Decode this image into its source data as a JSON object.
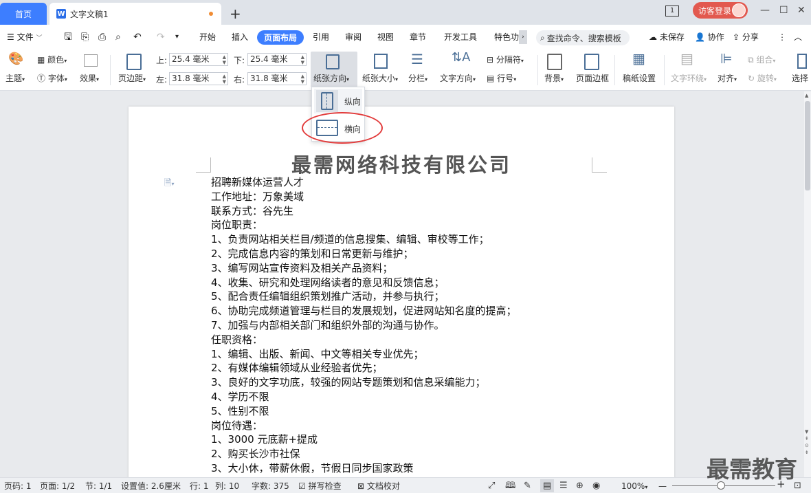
{
  "titlebar": {
    "home_tab": "首页",
    "doc_tab": "文字文稿1",
    "new_tab": "+",
    "page_indicator": "1",
    "login": "访客登录",
    "min": "—",
    "max": "☐",
    "close": "✕"
  },
  "menubar": {
    "file": "文件",
    "tabs": [
      "开始",
      "插入",
      "页面布局",
      "引用",
      "审阅",
      "视图",
      "章节",
      "开发工具",
      "特色功"
    ],
    "active_tab": "页面布局",
    "search": "查找命令、搜索模板",
    "unsaved": "未保存",
    "collab": "协作",
    "share": "分享"
  },
  "ribbon": {
    "theme": "主题",
    "color": "颜色",
    "font": "字体",
    "effect": "效果",
    "margins": "页边距",
    "top_label": "上:",
    "top_value": "25.4 毫米",
    "bottom_label": "下:",
    "bottom_value": "25.4 毫米",
    "left_label": "左:",
    "left_value": "31.8 毫米",
    "right_label": "右:",
    "right_value": "31.8 毫米",
    "orientation": "纸张方向",
    "size": "纸张大小",
    "columns": "分栏",
    "text_dir": "文字方向",
    "separator": "分隔符",
    "line_num": "行号",
    "background": "背景",
    "page_border": "页面边框",
    "manuscript": "稿纸设置",
    "text_wrap": "文字环绕",
    "align": "对齐",
    "group": "组合",
    "rotate": "旋转",
    "select": "选择"
  },
  "dropdown": {
    "portrait": "纵向",
    "landscape": "横向"
  },
  "document": {
    "title": "最需网络科技有限公司",
    "lines": [
      "招聘新媒体运营人才",
      "工作地址：万象美域",
      "联系方式：谷先生",
      "岗位职责：",
      "1、负责网站相关栏目/频道的信息搜集、编辑、审校等工作；",
      "2、完成信息内容的策划和日常更新与维护；",
      "3、编写网站宣传资料及相关产品资料；",
      "4、收集、研究和处理网络读者的意见和反馈信息；",
      "5、配合责任编辑组织策划推广活动，并参与执行；",
      "6、协助完成频道管理与栏目的发展规划，促进网站知名度的提高；",
      "7、加强与内部相关部门和组织外部的沟通与协作。",
      "任职资格：",
      "1、编辑、出版、新闻、中文等相关专业优先；",
      "2、有媒体编辑领域从业经验者优先；",
      "3、良好的文字功底，较强的网站专题策划和信息采编能力；",
      "4、学历不限",
      "5、性别不限",
      "岗位待遇：",
      "1、3000 元底薪+提成",
      "2、购买长沙市社保",
      "3、大小休，带薪休假，节假日同步国家政策"
    ]
  },
  "status": {
    "page_code": "页码: 1",
    "page": "页面: 1/2",
    "section": "节: 1/1",
    "setting": "设置值: 2.6厘米",
    "row": "行: 1",
    "col": "列: 10",
    "words": "字数: 375",
    "spell": "拼写检查",
    "proof": "文档校对",
    "zoom": "100%",
    "minus": "—",
    "plus": "+"
  },
  "watermark": "最需教育"
}
